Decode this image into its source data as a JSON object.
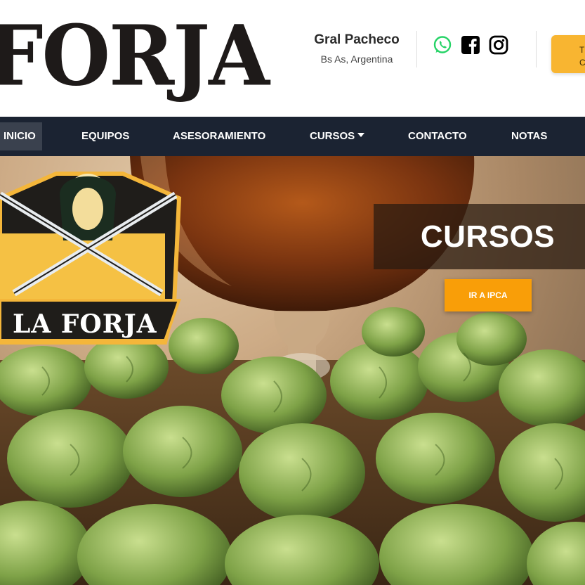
{
  "header": {
    "brand": "FORJA",
    "location": {
      "city": "Gral Pacheco",
      "country": "Bs As, Argentina"
    },
    "social": [
      {
        "name": "whatsapp-icon",
        "color": "#25d366"
      },
      {
        "name": "facebook-icon",
        "color": "#000000"
      },
      {
        "name": "instagram-icon",
        "color": "#000000"
      }
    ],
    "cta": {
      "line1": "T",
      "line2": "C"
    }
  },
  "nav": {
    "items": [
      {
        "label": "INICIO",
        "active": true
      },
      {
        "label": "EQUIPOS"
      },
      {
        "label": "ASESORAMIENTO"
      },
      {
        "label": "CURSOS",
        "dropdown": true
      },
      {
        "label": "CONTACTO"
      },
      {
        "label": "NOTAS"
      }
    ]
  },
  "hero": {
    "caption": "CURSOS",
    "button": "IR A IPCA",
    "badge_text": "LA FORJA"
  },
  "colors": {
    "nav_bg": "#1b2332",
    "accent": "#f99e08",
    "cta": "#f8b531",
    "brand_text": "#1e1a19"
  }
}
